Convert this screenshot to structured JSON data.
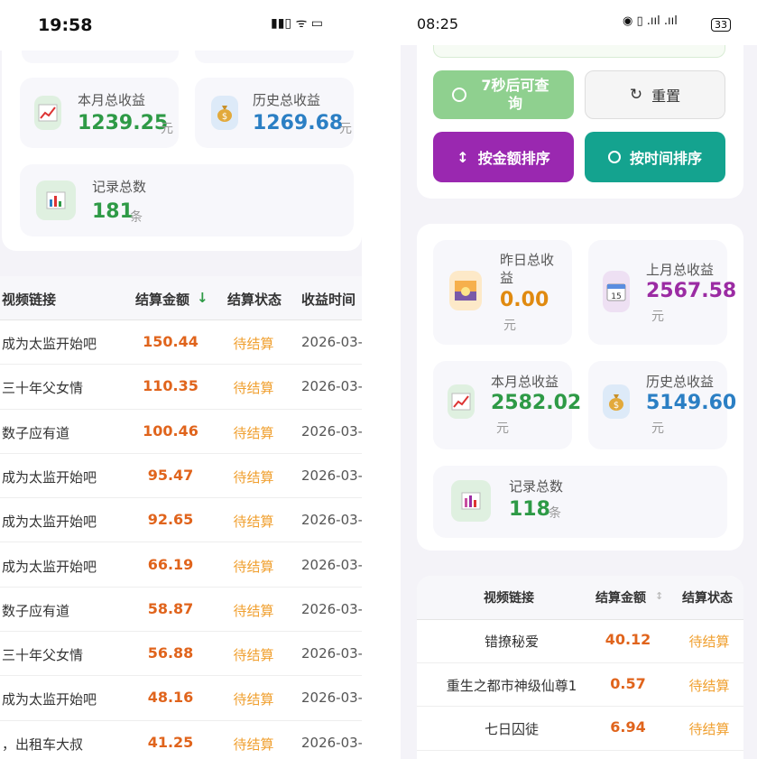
{
  "left": {
    "status_time": "19:58",
    "status_icons": "▮▮▯ ᯤ ▭",
    "stats": {
      "month_label": "本月总收益",
      "month_value": "1239.25",
      "month_unit": "元",
      "history_label": "历史总收益",
      "history_value": "1269.68",
      "history_unit": "元",
      "count_label": "记录总数",
      "count_value": "181",
      "count_unit": "条"
    },
    "table": {
      "headers": [
        "视频链接",
        "结算金额",
        "结算状态",
        "收益时间"
      ],
      "sort_arrow": "↓",
      "rows": [
        [
          "成为太监开始吧",
          "150.44",
          "待结算",
          "2026-03-"
        ],
        [
          "三十年父女情",
          "110.35",
          "待结算",
          "2026-03-"
        ],
        [
          "数子应有道",
          "100.46",
          "待结算",
          "2026-03-"
        ],
        [
          "成为太监开始吧",
          "95.47",
          "待结算",
          "2026-03-"
        ],
        [
          "成为太监开始吧",
          "92.65",
          "待结算",
          "2026-03-"
        ],
        [
          "成为太监开始吧",
          "66.19",
          "待结算",
          "2026-03-"
        ],
        [
          "数子应有道",
          "58.87",
          "待结算",
          "2026-03-"
        ],
        [
          "三十年父女情",
          "56.88",
          "待结算",
          "2026-03-"
        ],
        [
          "成为太监开始吧",
          "48.16",
          "待结算",
          "2026-03-"
        ],
        [
          "，出租车大叔",
          "41.25",
          "待结算",
          "2026-03-"
        ]
      ]
    }
  },
  "right": {
    "status_time": "08:25",
    "status_icons": "◉ ▯ .ııl .ııl",
    "battery": "33",
    "buttons": {
      "query": "7秒后可查询",
      "reset": "重置",
      "sort_amount": "按金额排序",
      "sort_time": "按时间排序"
    },
    "stats": {
      "yesterday_label": "昨日总收益",
      "yesterday_value": "0.00",
      "yesterday_unit": "元",
      "lastmonth_label": "上月总收益",
      "lastmonth_value": "2567.58",
      "lastmonth_unit": "元",
      "month_label": "本月总收益",
      "month_value": "2582.02",
      "month_unit": "元",
      "history_label": "历史总收益",
      "history_value": "5149.60",
      "history_unit": "元",
      "count_label": "记录总数",
      "count_value": "118",
      "count_unit": "条",
      "calendar_day": "15"
    },
    "table": {
      "headers": [
        "视频链接",
        "结算金额",
        "结算状态"
      ],
      "sort_arrow": "↕",
      "rows": [
        [
          "错撩秘爱",
          "40.12",
          "待结算"
        ],
        [
          "重生之都市神级仙尊1",
          "0.57",
          "待结算"
        ],
        [
          "七日囚徒",
          "6.94",
          "待结算"
        ]
      ]
    }
  },
  "colors": {
    "green": "#2e9a46",
    "blue": "#2b7fc4",
    "orange": "#e0641c",
    "purple": "#9b2ba3",
    "pending": "#f0a030",
    "btn_green": "#8fd08f",
    "btn_purple": "#9a28b0",
    "btn_teal": "#14a38f"
  },
  "icons": [
    "chart-icon",
    "money-bag-icon",
    "bar-chart-icon",
    "clock-icon",
    "reset-icon",
    "sort-icon",
    "sunset-icon",
    "calendar-icon"
  ]
}
